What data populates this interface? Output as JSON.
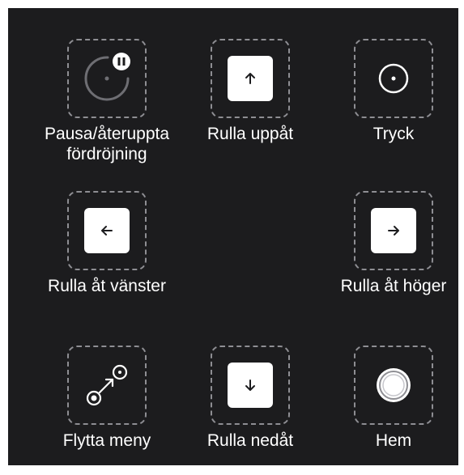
{
  "accent_color": "#ffffff",
  "background_color": "#1c1c1e",
  "items": [
    {
      "id": "pause",
      "label": "Pausa/återuppta\nfördröjning",
      "icon": "pause-timer-icon"
    },
    {
      "id": "scroll-up",
      "label": "Rulla uppåt",
      "icon": "arrow-up-icon"
    },
    {
      "id": "tap",
      "label": "Tryck",
      "icon": "tap-circle-icon"
    },
    {
      "id": "scroll-left",
      "label": "Rulla åt vänster",
      "icon": "arrow-left-icon"
    },
    {
      "id": "scroll-right",
      "label": "Rulla åt höger",
      "icon": "arrow-right-icon"
    },
    {
      "id": "move-menu",
      "label": "Flytta meny",
      "icon": "move-menu-icon"
    },
    {
      "id": "scroll-down",
      "label": "Rulla nedåt",
      "icon": "arrow-down-icon"
    },
    {
      "id": "home",
      "label": "Hem",
      "icon": "home-button-icon"
    }
  ]
}
